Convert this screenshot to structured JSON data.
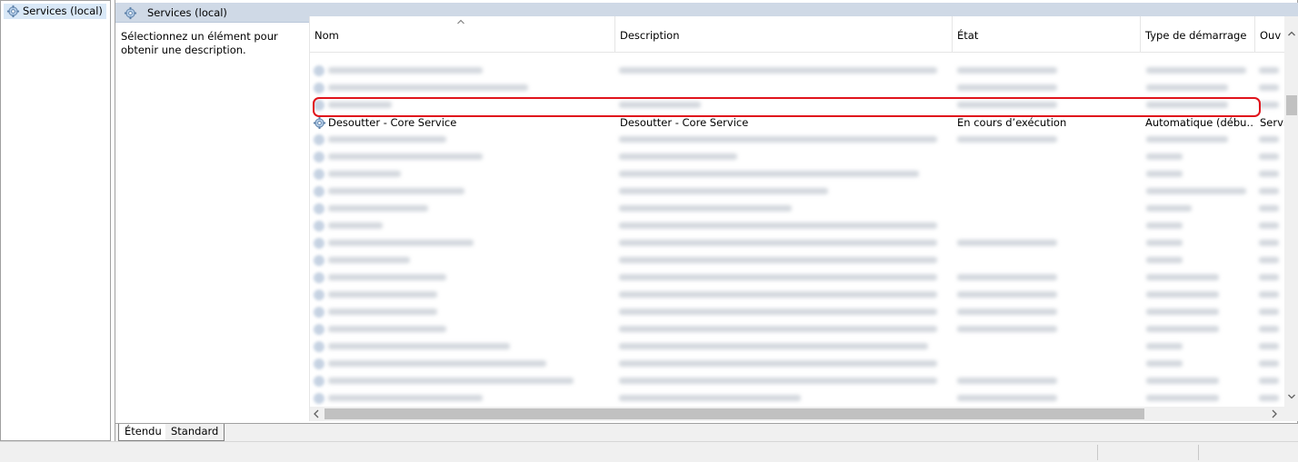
{
  "tree": {
    "root_label": "Services (local)"
  },
  "main": {
    "header_title": "Services (local)",
    "description_prompt": "Sélectionnez un élément pour obtenir une description."
  },
  "list": {
    "columns": [
      "Nom",
      "Description",
      "État",
      "Type de démarrage",
      "Ouv"
    ],
    "selected_row": {
      "name": "Desoutter - Core Service",
      "description": "Desoutter - Core Service",
      "state": "En cours d’exécution",
      "startup_type": "Automatique (débu…",
      "logon": "Servi"
    }
  },
  "tabs": [
    "Étendu",
    "Standard"
  ],
  "icons": {
    "service": "gear-icon",
    "tree_root": "gear-icon",
    "sort": "sort-up-icon"
  },
  "colors": {
    "highlight_ring": "#e0141c",
    "header_band": "#cfd9e6",
    "tree_selection": "#d9e8f7"
  }
}
